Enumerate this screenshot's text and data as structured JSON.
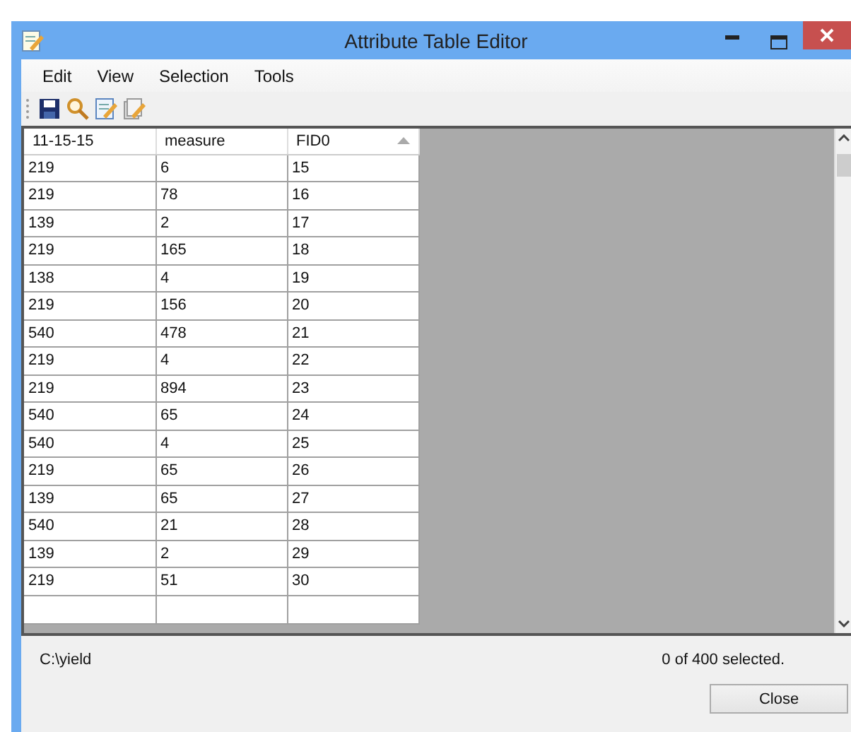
{
  "window": {
    "title": "Attribute Table Editor"
  },
  "menu": [
    "Edit",
    "View",
    "Selection",
    "Tools"
  ],
  "table": {
    "columns": [
      {
        "label": "11-15-15",
        "sorted": false
      },
      {
        "label": "measure",
        "sorted": false
      },
      {
        "label": "FID0",
        "sorted": true
      }
    ],
    "rows": [
      [
        "219",
        "6",
        "15"
      ],
      [
        "219",
        "78",
        "16"
      ],
      [
        "139",
        "2",
        "17"
      ],
      [
        "219",
        "165",
        "18"
      ],
      [
        "138",
        "4",
        "19"
      ],
      [
        "219",
        "156",
        "20"
      ],
      [
        "540",
        "478",
        "21"
      ],
      [
        "219",
        "4",
        "22"
      ],
      [
        "219",
        "894",
        "23"
      ],
      [
        "540",
        "65",
        "24"
      ],
      [
        "540",
        "4",
        "25"
      ],
      [
        "219",
        "65",
        "26"
      ],
      [
        "139",
        "65",
        "27"
      ],
      [
        "540",
        "21",
        "28"
      ],
      [
        "139",
        "2",
        "29"
      ],
      [
        "219",
        "51",
        "30"
      ]
    ]
  },
  "status_bar": {
    "path": "C:\\yield",
    "selection": "0  of 400 selected."
  },
  "buttons": [
    "Close"
  ]
}
